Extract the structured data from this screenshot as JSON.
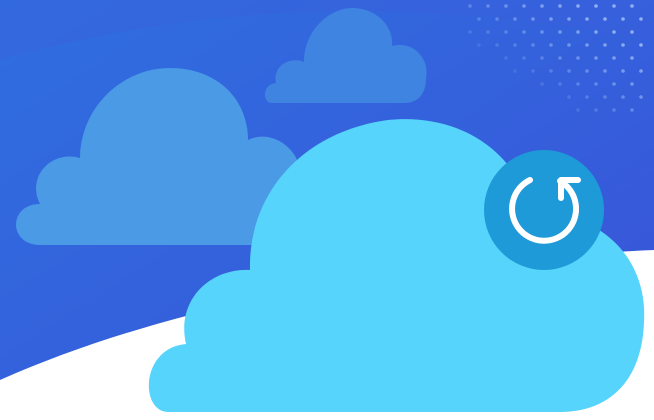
{
  "illustration": {
    "subject": "cloud-sync",
    "icons": [
      "cloud-icon",
      "refresh-icon"
    ],
    "colors": {
      "sky_top": "#3a52d8",
      "sky_bottom": "#2f6fe0",
      "cloud_back": "#4a9ae6",
      "cloud_small": "#3f84e0",
      "cloud_main": "#56d4fb",
      "badge": "#1e9ad9",
      "ground": "#ffffff",
      "dots": "#8fb0f2"
    }
  }
}
